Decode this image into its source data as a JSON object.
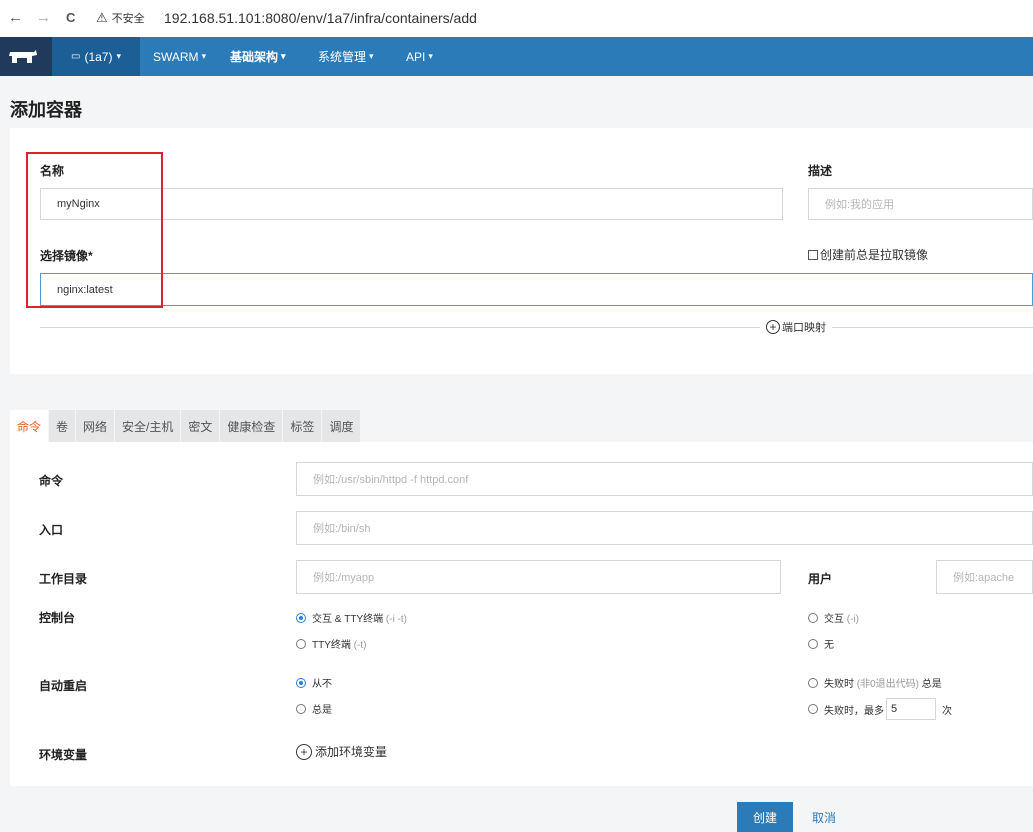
{
  "browser": {
    "back": "←",
    "forward": "→",
    "reload": "C",
    "warning": "不安全",
    "url": "192.168.51.101:8080/env/1a7/infra/containers/add"
  },
  "nav": {
    "env": "(1a7)",
    "items": [
      "SWARM",
      "基础架构",
      "系统管理",
      "API"
    ]
  },
  "page": {
    "title": "添加容器"
  },
  "form": {
    "name_label": "名称",
    "name_value": "myNginx",
    "desc_label": "描述",
    "desc_placeholder": "例如:我的应用",
    "image_label": "选择镜像*",
    "image_value": "nginx:latest",
    "pull_label": "创建前总是拉取镜像",
    "port_map": "端口映射"
  },
  "tabs": [
    "命令",
    "卷",
    "网络",
    "安全/主机",
    "密文",
    "健康检查",
    "标签",
    "调度"
  ],
  "command": {
    "cmd_label": "命令",
    "cmd_placeholder": "例如:/usr/sbin/httpd -f httpd.conf",
    "entry_label": "入口",
    "entry_placeholder": "例如:/bin/sh",
    "workdir_label": "工作目录",
    "workdir_placeholder": "例如:/myapp",
    "user_label": "用户",
    "user_placeholder": "例如:apache",
    "console_label": "控制台",
    "console_opt1": "交互 & TTY终端",
    "console_opt1_sub": "(-i -t)",
    "console_opt2": "TTY终端",
    "console_opt2_sub": "(-t)",
    "console_opt3": "交互",
    "console_opt3_sub": "(-i)",
    "console_opt4": "无",
    "restart_label": "自动重启",
    "restart_opt1": "从不",
    "restart_opt2": "总是",
    "restart_opt3": "失败时",
    "restart_opt3_sub": "(非0退出代码)",
    "restart_opt3_tail": "总是",
    "restart_opt4": "失败时，最多",
    "restart_max": "5",
    "restart_unit": "次",
    "env_label": "环境变量",
    "env_add": "添加环境变量"
  },
  "buttons": {
    "create": "创建",
    "cancel": "取消"
  },
  "colors": {
    "nav": "#2b7bb9",
    "accent_tab": "#e8602c",
    "highlight": "#d9232d"
  }
}
